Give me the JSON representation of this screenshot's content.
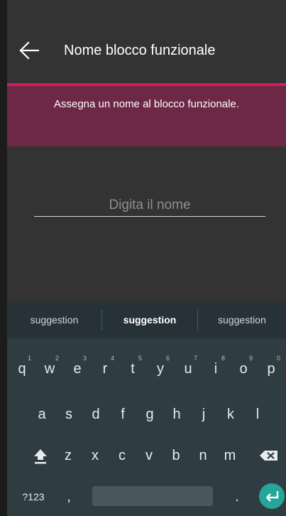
{
  "header": {
    "title": "Nome blocco funzionale",
    "back_icon": "arrow-left-icon"
  },
  "banner": {
    "text": "Assegna un nome al blocco funzionale."
  },
  "name_input": {
    "value": "",
    "placeholder": "Digita il nome"
  },
  "suggestions": [
    "suggestion",
    "suggestion",
    "suggestion"
  ],
  "keyboard": {
    "row1": [
      {
        "key": "q",
        "hint": "1"
      },
      {
        "key": "w",
        "hint": "2"
      },
      {
        "key": "e",
        "hint": "3"
      },
      {
        "key": "r",
        "hint": "4"
      },
      {
        "key": "t",
        "hint": "5"
      },
      {
        "key": "y",
        "hint": "6"
      },
      {
        "key": "u",
        "hint": "7"
      },
      {
        "key": "i",
        "hint": "8"
      },
      {
        "key": "o",
        "hint": "9"
      },
      {
        "key": "p",
        "hint": "0"
      }
    ],
    "row2": [
      "a",
      "s",
      "d",
      "f",
      "g",
      "h",
      "j",
      "k",
      "l"
    ],
    "row3": [
      "z",
      "x",
      "c",
      "v",
      "b",
      "n",
      "m"
    ],
    "symbols_key": "?123",
    "comma_key": ",",
    "period_key": "."
  },
  "colors": {
    "accent": "#d81b60",
    "banner_bg": "#6d2845",
    "enter_key": "#26a69a"
  }
}
